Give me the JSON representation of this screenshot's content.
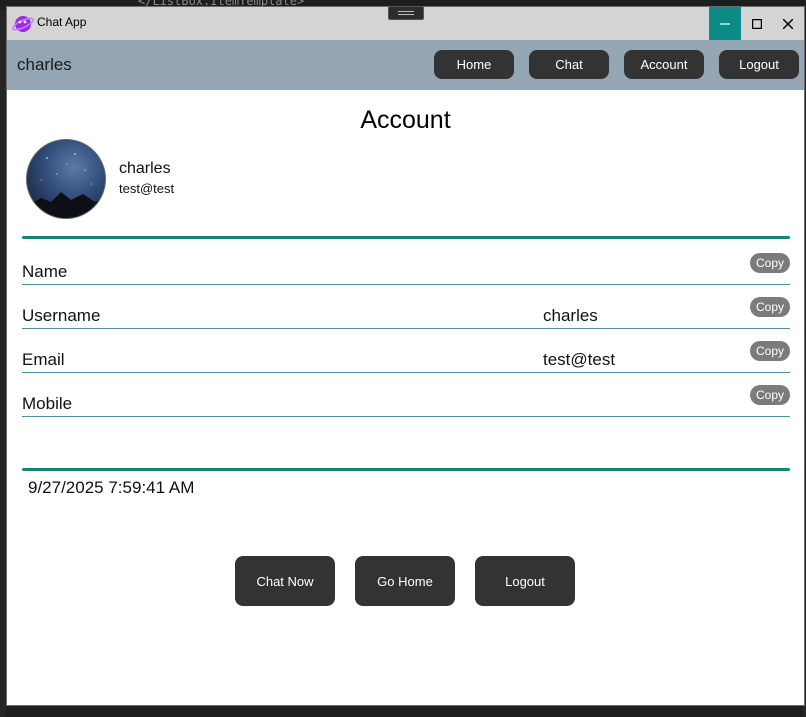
{
  "background_code_text": "</ListBox.ItemTemplate>",
  "window": {
    "title": "Chat App",
    "accent_color": "#0b8a86"
  },
  "navbar": {
    "username": "charles",
    "buttons": [
      "Home",
      "Chat",
      "Account",
      "Logout"
    ],
    "bar_color": "#94a6b4"
  },
  "page": {
    "title": "Account"
  },
  "profile": {
    "name": "charles",
    "email": "test@test"
  },
  "fields": [
    {
      "label": "Name",
      "value": "",
      "action": "Copy"
    },
    {
      "label": "Username",
      "value": "charles",
      "action": "Copy"
    },
    {
      "label": "Email",
      "value": "test@test",
      "action": "Copy"
    },
    {
      "label": "Mobile",
      "value": "",
      "action": "Copy"
    }
  ],
  "timestamp": "9/27/2025 7:59:41 AM",
  "actions": [
    "Chat Now",
    "Go Home",
    "Logout"
  ],
  "divider_color": "#138577"
}
